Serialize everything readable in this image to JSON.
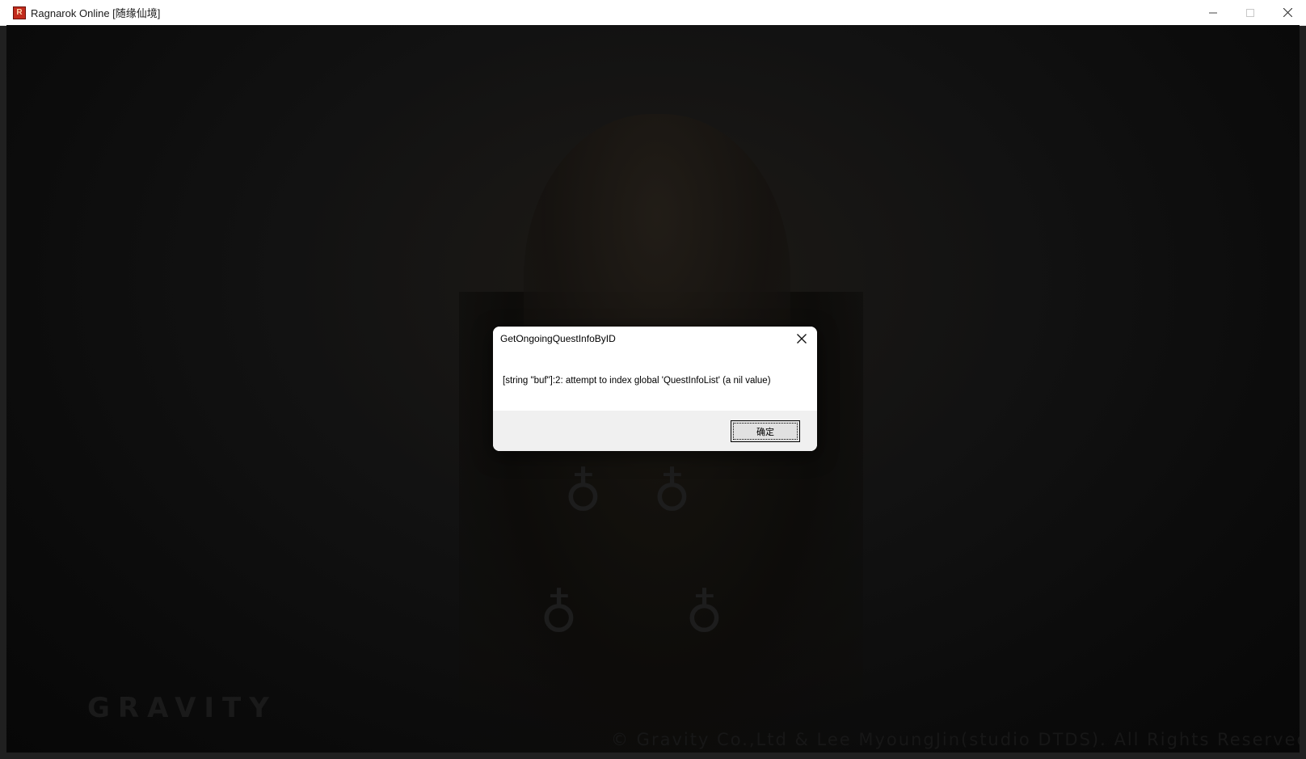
{
  "window": {
    "title": "Ragnarok Online [随缘仙境]",
    "icon": "ro-app-icon",
    "icon_glyph": "R",
    "controls": [
      "minimize-icon",
      "maximize-icon",
      "close-icon"
    ]
  },
  "background": {
    "logo_text": "GRAVITY",
    "copyright_text": "© Gravity Co.,Ltd & Lee MyoungJin(studio DTDS). All Rights Reserved."
  },
  "dialog": {
    "title": "GetOngoingQuestInfoByID",
    "message": "[string \"buf\"]:2: attempt to index global 'QuestInfoList' (a nil value)",
    "ok_label": "确定"
  },
  "colors": {
    "titlebar_bg": "#ffffff",
    "game_bg": "#0b0b0b",
    "dialog_body": "#ffffff",
    "dialog_footer": "#f0f0f0"
  }
}
